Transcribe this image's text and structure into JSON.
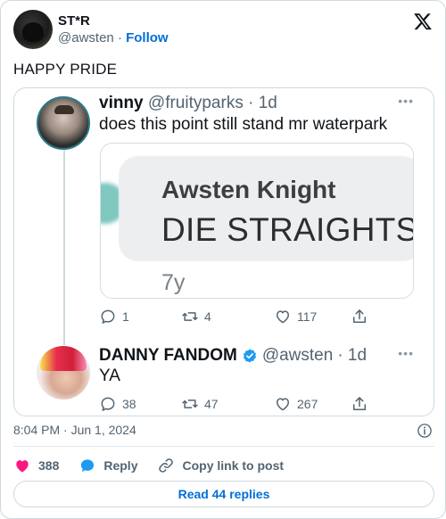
{
  "author": {
    "display_name": "ST*R",
    "handle": "@awsten",
    "separator": "·",
    "follow_label": "Follow"
  },
  "tweet": {
    "text": "HAPPY PRIDE",
    "timestamp": "8:04 PM · Jun 1, 2024"
  },
  "screenshot": {
    "quoted": {
      "name": "vinny",
      "handle": "@fruityparks",
      "age": "· 1d",
      "text": "does this point still stand mr waterpark",
      "inner_image": {
        "name": "Awsten Knight",
        "text": "DIE STRAIGHTS",
        "age": "7y"
      },
      "actions": {
        "replies": "1",
        "retweets": "4",
        "likes": "117"
      }
    },
    "reply": {
      "name": "DANNY FANDOM",
      "handle": "@awsten",
      "age": "· 1d",
      "text": "YA",
      "actions": {
        "replies": "38",
        "retweets": "47",
        "likes": "267"
      }
    }
  },
  "footer": {
    "like_count": "388",
    "reply_label": "Reply",
    "copy_link_label": "Copy link to post",
    "read_replies_label": "Read 44 replies"
  },
  "colors": {
    "like": "#f91880",
    "link": "#006fd6",
    "verified": "#1d9bf0"
  }
}
